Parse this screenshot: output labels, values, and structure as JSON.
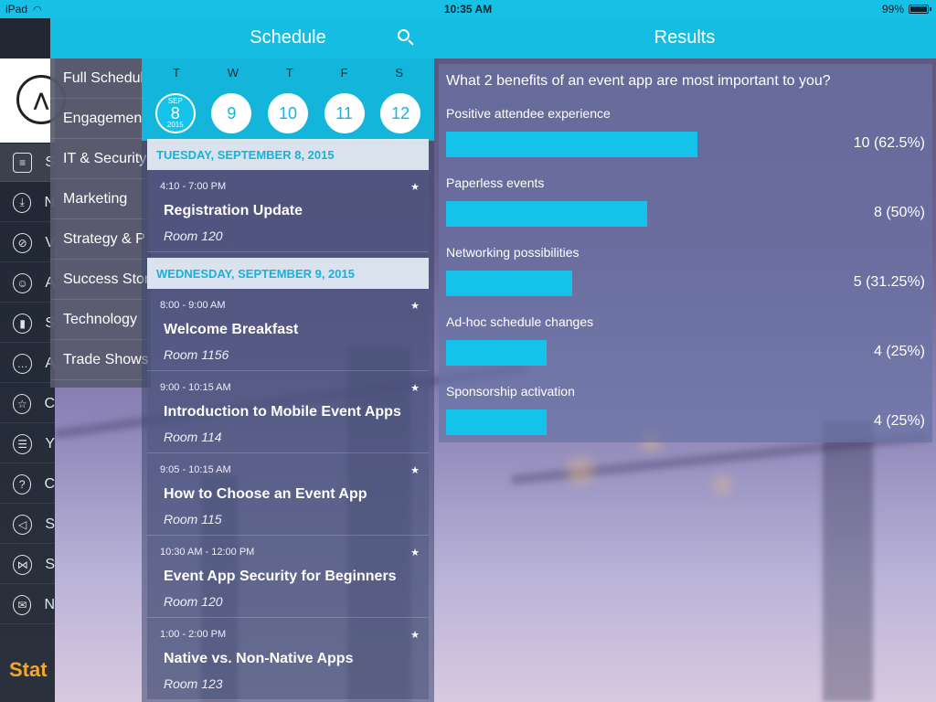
{
  "status_bar": {
    "device": "iPad",
    "time": "10:35 AM",
    "battery": "99%"
  },
  "sidebar": {
    "items": [
      {
        "icon": "menu-icon",
        "label": "S"
      },
      {
        "icon": "download-icon",
        "label": "N"
      },
      {
        "icon": "compass-icon",
        "label": "V"
      },
      {
        "icon": "person-icon",
        "label": "A"
      },
      {
        "icon": "badge-icon",
        "label": "S"
      },
      {
        "icon": "chat-icon",
        "label": "A"
      },
      {
        "icon": "star-icon",
        "label": "C"
      },
      {
        "icon": "checklist-icon",
        "label": "Y"
      },
      {
        "icon": "help-icon",
        "label": "C"
      },
      {
        "icon": "megaphone-icon",
        "label": "S"
      },
      {
        "icon": "share-icon",
        "label": "S"
      },
      {
        "icon": "mail-icon",
        "label": "N"
      }
    ],
    "brand_text": "Stat"
  },
  "categories": {
    "items": [
      "Full Schedule",
      "Engagement",
      "IT & Security",
      "Marketing",
      "Strategy & P",
      "Success Stories",
      "Technology",
      "Trade Shows"
    ]
  },
  "schedule": {
    "title": "Schedule",
    "weekdays": [
      "T",
      "W",
      "T",
      "F",
      "S"
    ],
    "dates": [
      {
        "month": "SEP",
        "day": "8",
        "year": "2015",
        "selected": true
      },
      {
        "day": "9"
      },
      {
        "day": "10"
      },
      {
        "day": "11"
      },
      {
        "day": "12"
      }
    ],
    "days": [
      {
        "header": "TUESDAY, SEPTEMBER 8, 2015",
        "events": [
          {
            "time": "4:10 - 7:00 PM",
            "name": "Registration  Update",
            "room": "Room 120"
          }
        ]
      },
      {
        "header": "WEDNESDAY, SEPTEMBER 9, 2015",
        "events": [
          {
            "time": "8:00 - 9:00 AM",
            "name": "Welcome Breakfast",
            "room": "Room 1156"
          },
          {
            "time": "9:00 - 10:15 AM",
            "name": "Introduction to Mobile Event Apps",
            "room": "Room 114"
          },
          {
            "time": "9:05 - 10:15 AM",
            "name": "How to Choose an Event App",
            "room": "Room 115"
          },
          {
            "time": "10:30 AM - 12:00 PM",
            "name": "Event App Security for Beginners",
            "room": "Room 120"
          },
          {
            "time": "1:00 - 2:00 PM",
            "name": "Native vs. Non-Native Apps",
            "room": "Room 123"
          }
        ]
      }
    ]
  },
  "results": {
    "title": "Results",
    "question": "What 2 benefits of an event app are most important to you?",
    "answers": [
      {
        "label": "Positive attendee experience",
        "value": "10 (62.5%)",
        "fraction": 0.625
      },
      {
        "label": "Paperless events",
        "value": "8 (50%)",
        "fraction": 0.5
      },
      {
        "label": "Networking possibilities",
        "value": "5 (31.25%)",
        "fraction": 0.3125
      },
      {
        "label": "Ad-hoc schedule changes",
        "value": "4 (25%)",
        "fraction": 0.25
      },
      {
        "label": "Sponsorship activation",
        "value": "4 (25%)",
        "fraction": 0.25
      }
    ],
    "accent": "#15c3ea"
  }
}
